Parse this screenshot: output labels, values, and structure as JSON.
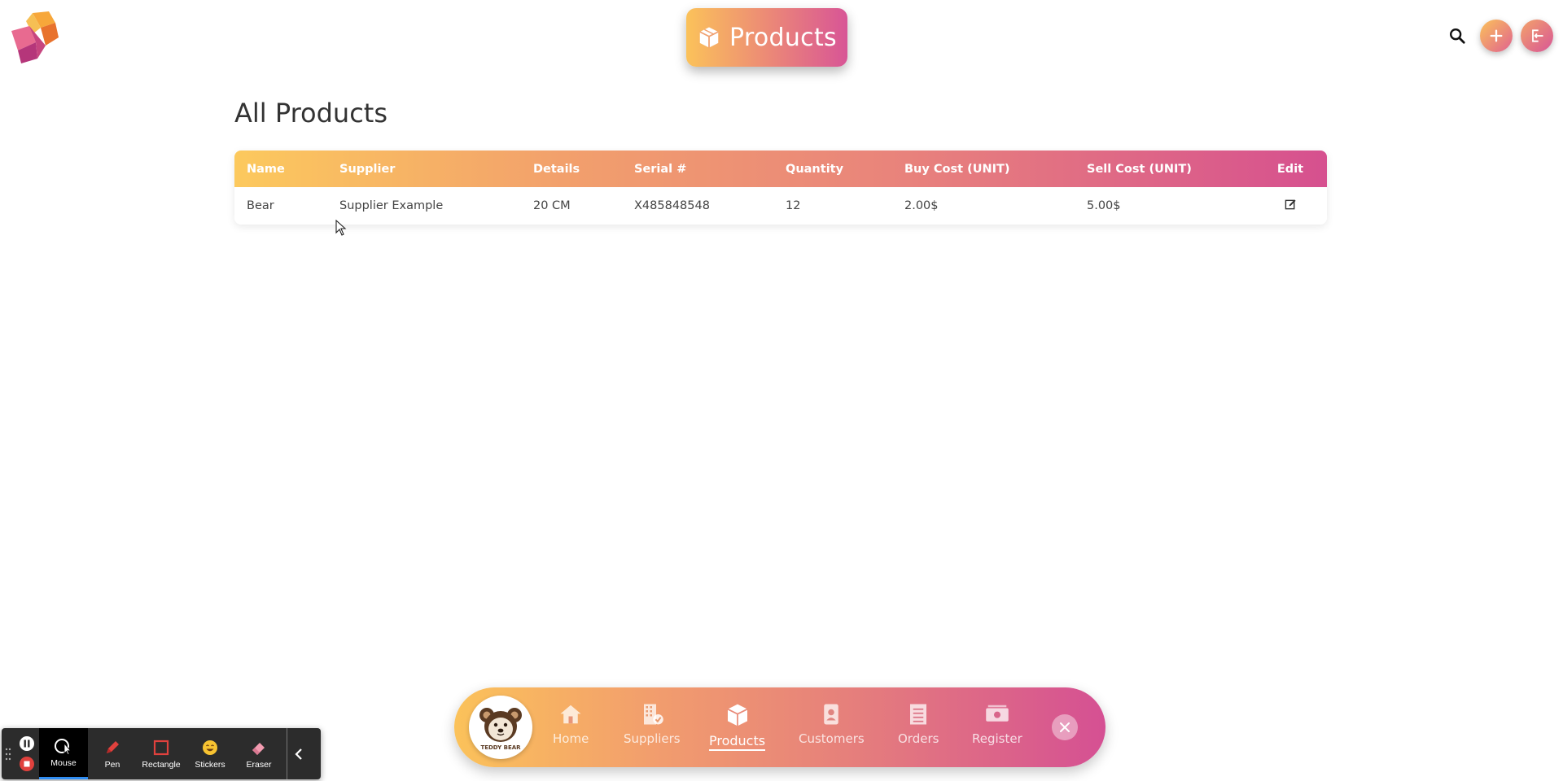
{
  "header": {
    "title": "Products",
    "icon": "box-icon"
  },
  "top_actions": {
    "search_icon": "search-icon",
    "add_icon": "plus-icon",
    "logout_icon": "exit-icon"
  },
  "main": {
    "heading": "All Products",
    "table": {
      "columns": [
        "Name",
        "Supplier",
        "Details",
        "Serial #",
        "Quantity",
        "Buy Cost (UNIT)",
        "Sell Cost (UNIT)",
        "Edit"
      ],
      "rows": [
        {
          "name": "Bear",
          "supplier": "Supplier Example",
          "details": "20 CM",
          "serial": "X485848548",
          "quantity": "12",
          "buy_cost": "2.00$",
          "sell_cost": "5.00$",
          "edit_icon": "edit-icon"
        }
      ]
    }
  },
  "bottom_nav": {
    "brand_text": "TEDDY BEAR",
    "items": [
      {
        "label": "Home",
        "icon": "home-icon"
      },
      {
        "label": "Suppliers",
        "icon": "building-icon"
      },
      {
        "label": "Products",
        "icon": "box-icon",
        "active": true
      },
      {
        "label": "Customers",
        "icon": "contact-icon"
      },
      {
        "label": "Orders",
        "icon": "list-icon"
      },
      {
        "label": "Register",
        "icon": "money-icon"
      }
    ],
    "close_icon": "close-icon"
  },
  "recorder": {
    "tools": [
      {
        "label": "Mouse",
        "icon": "mouse-icon",
        "active": true
      },
      {
        "label": "Pen",
        "icon": "pen-icon"
      },
      {
        "label": "Rectangle",
        "icon": "rectangle-icon"
      },
      {
        "label": "Stickers",
        "icon": "sticker-icon"
      },
      {
        "label": "Eraser",
        "icon": "eraser-icon"
      }
    ]
  },
  "colors": {
    "gradient_start": "#fbc25a",
    "gradient_mid": "#ec8a76",
    "gradient_end": "#d55093"
  }
}
